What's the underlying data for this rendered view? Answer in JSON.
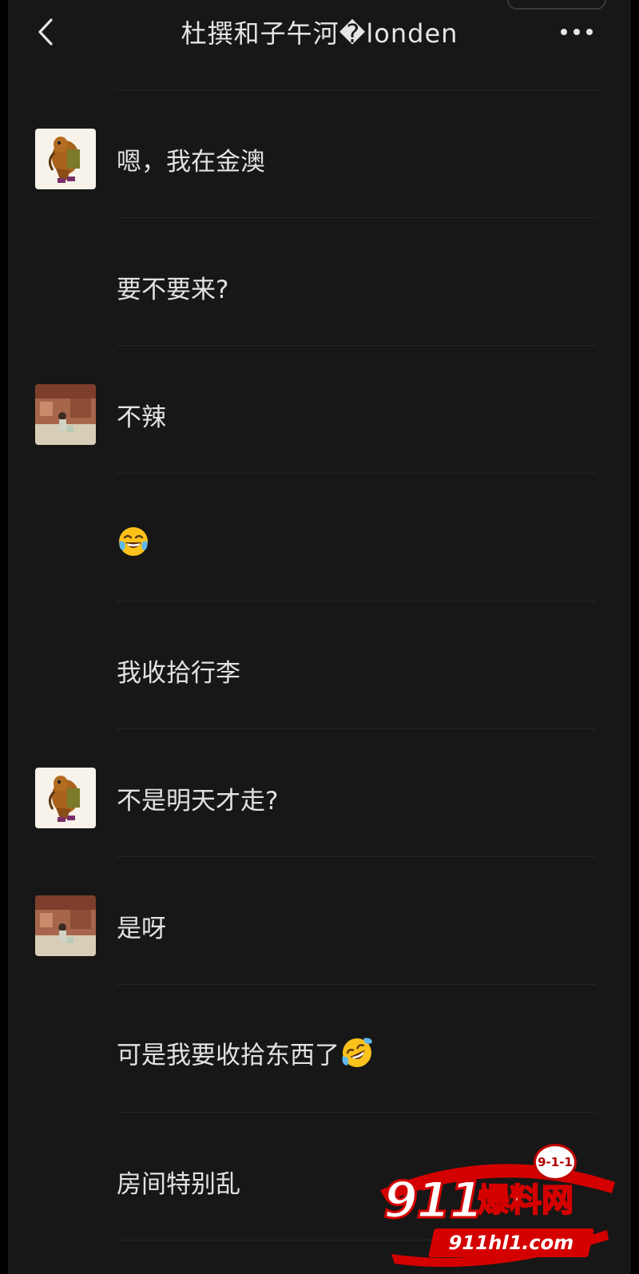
{
  "header": {
    "title": "杜撰和子午河�londen"
  },
  "messages": [
    {
      "avatar": "dog-cartoon",
      "text": "嗯，我在金澳",
      "emoji": ""
    },
    {
      "avatar": "",
      "text": "要不要来?",
      "emoji": ""
    },
    {
      "avatar": "person-photo",
      "text": "不辣",
      "emoji": ""
    },
    {
      "avatar": "",
      "text": "",
      "emoji": "tears-of-joy-emoji"
    },
    {
      "avatar": "",
      "text": "我收拾行李",
      "emoji": ""
    },
    {
      "avatar": "dog-cartoon",
      "text": "不是明天才走?",
      "emoji": ""
    },
    {
      "avatar": "person-photo",
      "text": "是呀",
      "emoji": ""
    },
    {
      "avatar": "",
      "text": "可是我要收拾东西了",
      "emoji": "rolling-laughing-emoji"
    },
    {
      "avatar": "",
      "text": "房间特别乱",
      "emoji": ""
    }
  ],
  "watermark": {
    "badge": "9-1-1",
    "number": "911",
    "chinese": "爆料网",
    "url": "911hl1.com"
  },
  "colors": {
    "background": "#171717",
    "text": "#e2e2e2",
    "divider": "#262626",
    "watermark_red": "#d40000"
  }
}
